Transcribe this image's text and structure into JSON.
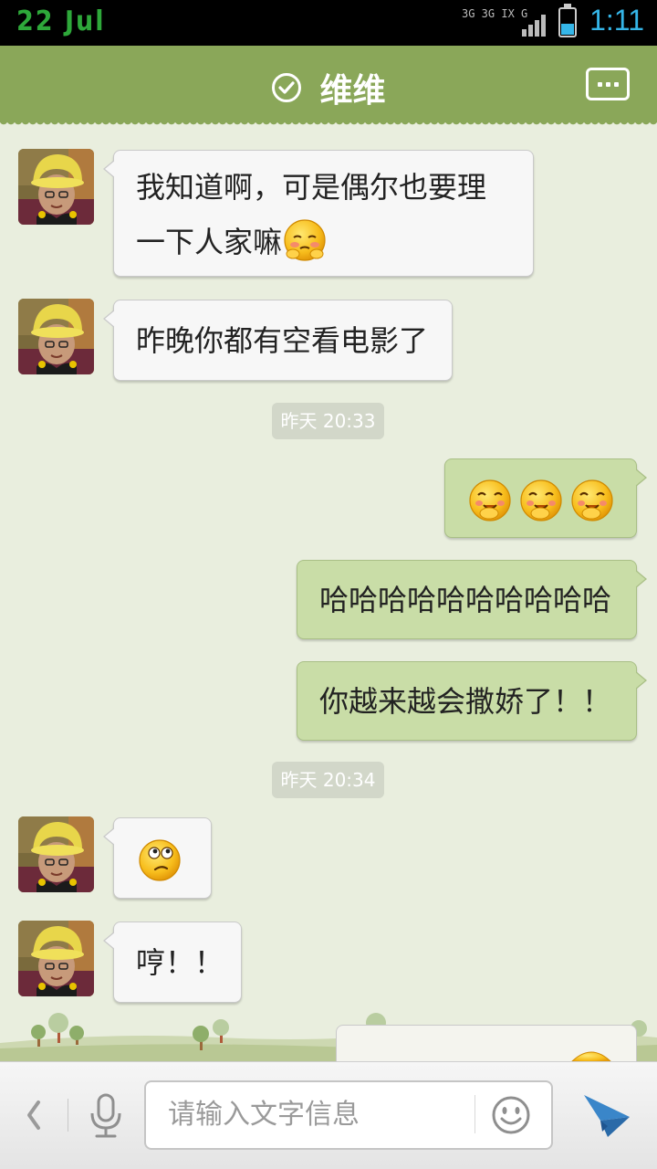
{
  "status_bar": {
    "date": "22 Jul",
    "network_top": "3G 3G IX G",
    "time": "1:11",
    "signal_icon": "signal-bars-icon",
    "battery_icon": "battery-icon"
  },
  "header": {
    "title": "维维",
    "verified_icon": "check-circle-icon",
    "more_icon": "more-dots-icon",
    "background_color": "#8aa759"
  },
  "messages": [
    {
      "side": "in",
      "text": "我知道啊，可是偶尔也要理",
      "text2": "一下人家嘛",
      "emoji": "shy-face"
    },
    {
      "side": "in",
      "text": "昨晚你都有空看电影了"
    },
    {
      "type": "time",
      "text": "昨天 20:33"
    },
    {
      "side": "out",
      "emoji": "giggle-face x3"
    },
    {
      "side": "out",
      "text": "哈哈哈哈哈哈哈哈哈哈"
    },
    {
      "side": "out",
      "text": "你越来越会撒娇了！！"
    },
    {
      "type": "time",
      "text": "昨天 20:34"
    },
    {
      "side": "in",
      "emoji": "confused-face"
    },
    {
      "side": "in",
      "text": "哼！！"
    }
  ],
  "input_bar": {
    "placeholder": "请输入文字信息",
    "back_icon": "chevron-left-icon",
    "voice_icon": "microphone-icon",
    "emoji_icon": "smiley-icon",
    "send_icon": "paper-plane-icon"
  },
  "colors": {
    "incoming_bubble": "#f7f7f7",
    "outgoing_bubble": "#c9dda7",
    "chat_background": "#e9eede",
    "accent_time": "#35b6e8"
  }
}
